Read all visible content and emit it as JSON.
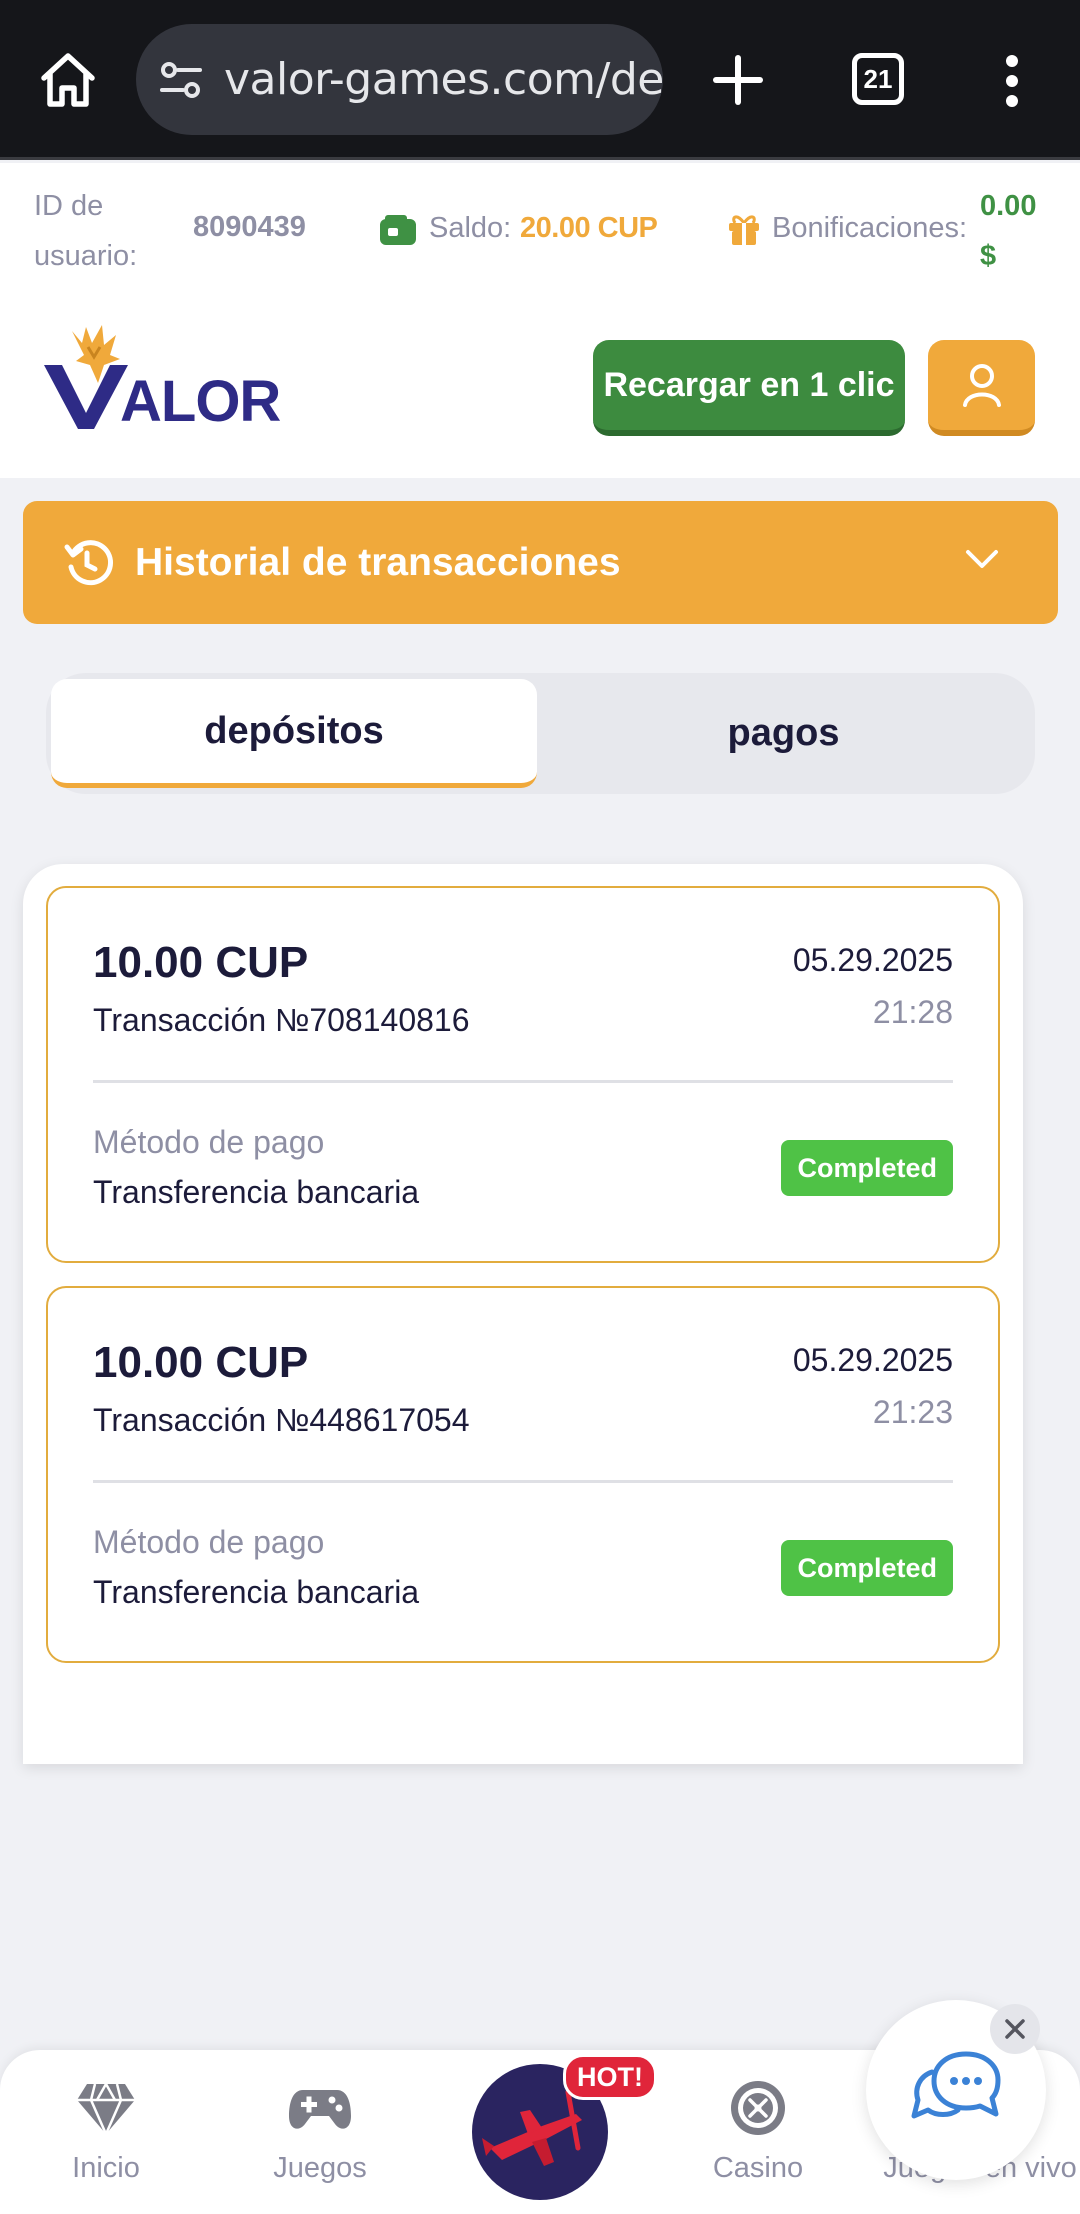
{
  "browser": {
    "url": "valor-games.com/de",
    "tab_count": "21",
    "icons": [
      "home-icon",
      "tune-icon",
      "plus-icon",
      "tabs-icon",
      "more-vert-icon"
    ]
  },
  "user_bar": {
    "id_label": "ID de usuario:",
    "id_value": "8090439",
    "balance_label": "Saldo:",
    "balance_value": "20.00 CUP",
    "bonus_label": "Bonificaciones:",
    "bonus_value": "0.00 $"
  },
  "header": {
    "logo_text": "VALOR",
    "recharge_label": "Recargar en 1 clic"
  },
  "history": {
    "title": "Historial de transacciones"
  },
  "tabs": [
    {
      "label": "depósitos",
      "active": true
    },
    {
      "label": "pagos",
      "active": false
    }
  ],
  "transactions": [
    {
      "amount": "10.00 CUP",
      "id": "Transacción №708140816",
      "date": "05.29.2025",
      "time": "21:28",
      "method_label": "Método de pago",
      "method": "Transferencia bancaria",
      "status": "Completed"
    },
    {
      "amount": "10.00 CUP",
      "id": "Transacción №448617054",
      "date": "05.29.2025",
      "time": "21:23",
      "method_label": "Método de pago",
      "method": "Transferencia bancaria",
      "status": "Completed"
    }
  ],
  "bottom_nav": {
    "items": [
      {
        "label": "Inicio",
        "icon": "diamond-icon"
      },
      {
        "label": "Juegos",
        "icon": "gamepad-icon"
      },
      {
        "label": "",
        "icon": "aviator-plane-icon"
      },
      {
        "label": "Casino",
        "icon": "roulette-icon"
      },
      {
        "label": "Juegos en vivo",
        "icon": "live-games-icon"
      }
    ],
    "hot_badge": "HOT!"
  },
  "colors": {
    "accent_orange": "#f0a93b",
    "green": "#3d8b3f",
    "status_green": "#4fc246",
    "navy": "#1c1b3a"
  }
}
